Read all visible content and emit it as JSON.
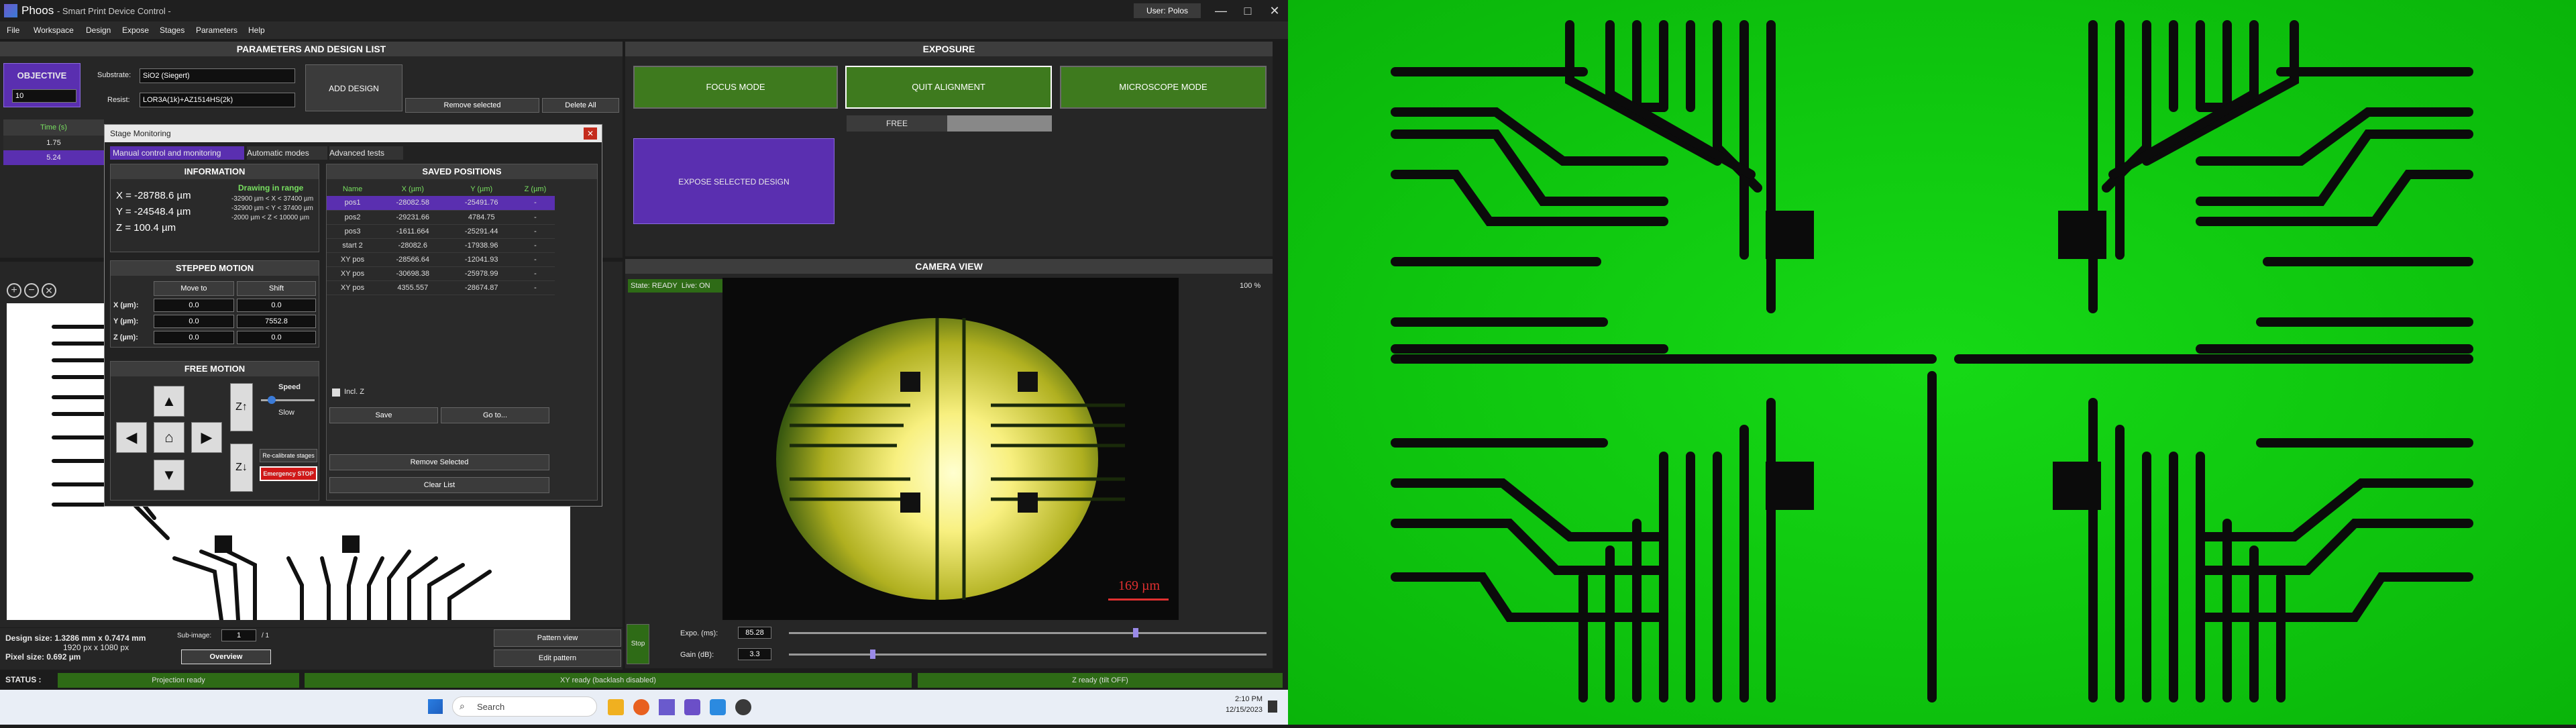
{
  "window": {
    "title": "Phoos",
    "subtitle": "- Smart Print Device Control -",
    "user": "User: Polos"
  },
  "menu": [
    "File",
    "Workspace",
    "Design",
    "Expose",
    "Stages",
    "Parameters",
    "Help"
  ],
  "params": {
    "header": "PARAMETERS AND DESIGN LIST",
    "objective_label": "OBJECTIVE",
    "objective_value": "10",
    "substrate_label": "Substrate:",
    "substrate_value": "SiO2 (Siegert)",
    "resist_label": "Resist:",
    "resist_value": "LOR3A(1k)+AZ1514HS(2k)",
    "add_design": "ADD DESIGN",
    "remove_selected": "Remove selected",
    "delete_all": "Delete All",
    "time_header": "Time (s)",
    "times": [
      "1.75",
      "5.24"
    ]
  },
  "dialog": {
    "title": "Stage Monitoring",
    "tabs": [
      "Manual control and monitoring",
      "Automatic modes",
      "Advanced tests"
    ],
    "info_header": "INFORMATION",
    "x": "X = -28788.6 µm",
    "y": "Y = -24548.4 µm",
    "z": "Z = 100.4 µm",
    "range_title": "Drawing in range",
    "range_lines": [
      "-32900 µm < X < 37400 µm",
      "-32900 µm < Y < 37400 µm",
      "-2000 µm < Z < 10000 µm"
    ],
    "stepped_header": "STEPPED MOTION",
    "move_to": "Move to",
    "shift": "Shift",
    "x_label": "X (µm):",
    "y_label": "Y (µm):",
    "z_label": "Z (µm):",
    "move_vals": [
      "0.0",
      "0.0",
      "0.0"
    ],
    "shift_vals": [
      "0.0",
      "7552.8",
      "0.0"
    ],
    "free_header": "FREE MOTION",
    "speed": "Speed",
    "slow": "Slow",
    "recalibrate": "Re-calibrate stages",
    "emergency": "Emergency STOP",
    "saved_header": "SAVED POSITIONS",
    "cols": [
      "Name",
      "X (µm)",
      "Y (µm)",
      "Z (µm)"
    ],
    "rows": [
      [
        "pos1",
        "-28082.58",
        "-25491.76",
        "-"
      ],
      [
        "pos2",
        "-29231.66",
        "4784.75",
        "-"
      ],
      [
        "pos3",
        "-1611.664",
        "-25291.44",
        "-"
      ],
      [
        "start 2",
        "-28082.6",
        "-17938.96",
        "-"
      ],
      [
        "XY pos",
        "-28566.64",
        "-12041.93",
        "-"
      ],
      [
        "XY pos",
        "-30698.38",
        "-25978.99",
        "-"
      ],
      [
        "XY pos",
        "4355.557",
        "-28674.87",
        "-"
      ]
    ],
    "incl_z": "Incl. Z",
    "save": "Save",
    "goto": "Go to...",
    "remove_selected": "Remove Selected",
    "clear_list": "Clear List"
  },
  "exposure": {
    "header": "EXPOSURE",
    "focus": "FOCUS MODE",
    "quit": "QUIT ALIGNMENT",
    "microscope": "MICROSCOPE MODE",
    "free": "FREE",
    "expose": "EXPOSE SELECTED DESIGN"
  },
  "camera": {
    "header": "CAMERA VIEW",
    "state": "State: READY",
    "live": "Live: ON",
    "zoom": "100 %",
    "scale": "169 µm",
    "stop_live": "Stop live",
    "expo_label": "Expo. (ms):",
    "expo_value": "85.28",
    "gain_label": "Gain (dB):",
    "gain_value": "3.3",
    "expo_level": 0.72,
    "gain_level": 0.17
  },
  "bottom": {
    "design_size": "Design size: 1.3286 mm x 0.7474 mm",
    "design_px": "1920 px x 1080 px",
    "pixel_size": "Pixel size: 0.692 µm",
    "subimage_label": "Sub-image:",
    "subimage_value": "1",
    "subimage_total": "/ 1",
    "overview": "Overview",
    "pattern_view": "Pattern view",
    "edit_pattern": "Edit pattern"
  },
  "status": {
    "label": "STATUS :",
    "projection": "Projection ready",
    "xy": "XY ready (backlash disabled)",
    "z": "Z ready (tilt OFF)"
  },
  "taskbar": {
    "search": "Search",
    "time": "2:10 PM",
    "date": "12/15/2023"
  },
  "colors": {
    "accent_purple": "#5a2fb0",
    "green_button": "#3e7a1e",
    "pattern_green": "#10c810"
  }
}
